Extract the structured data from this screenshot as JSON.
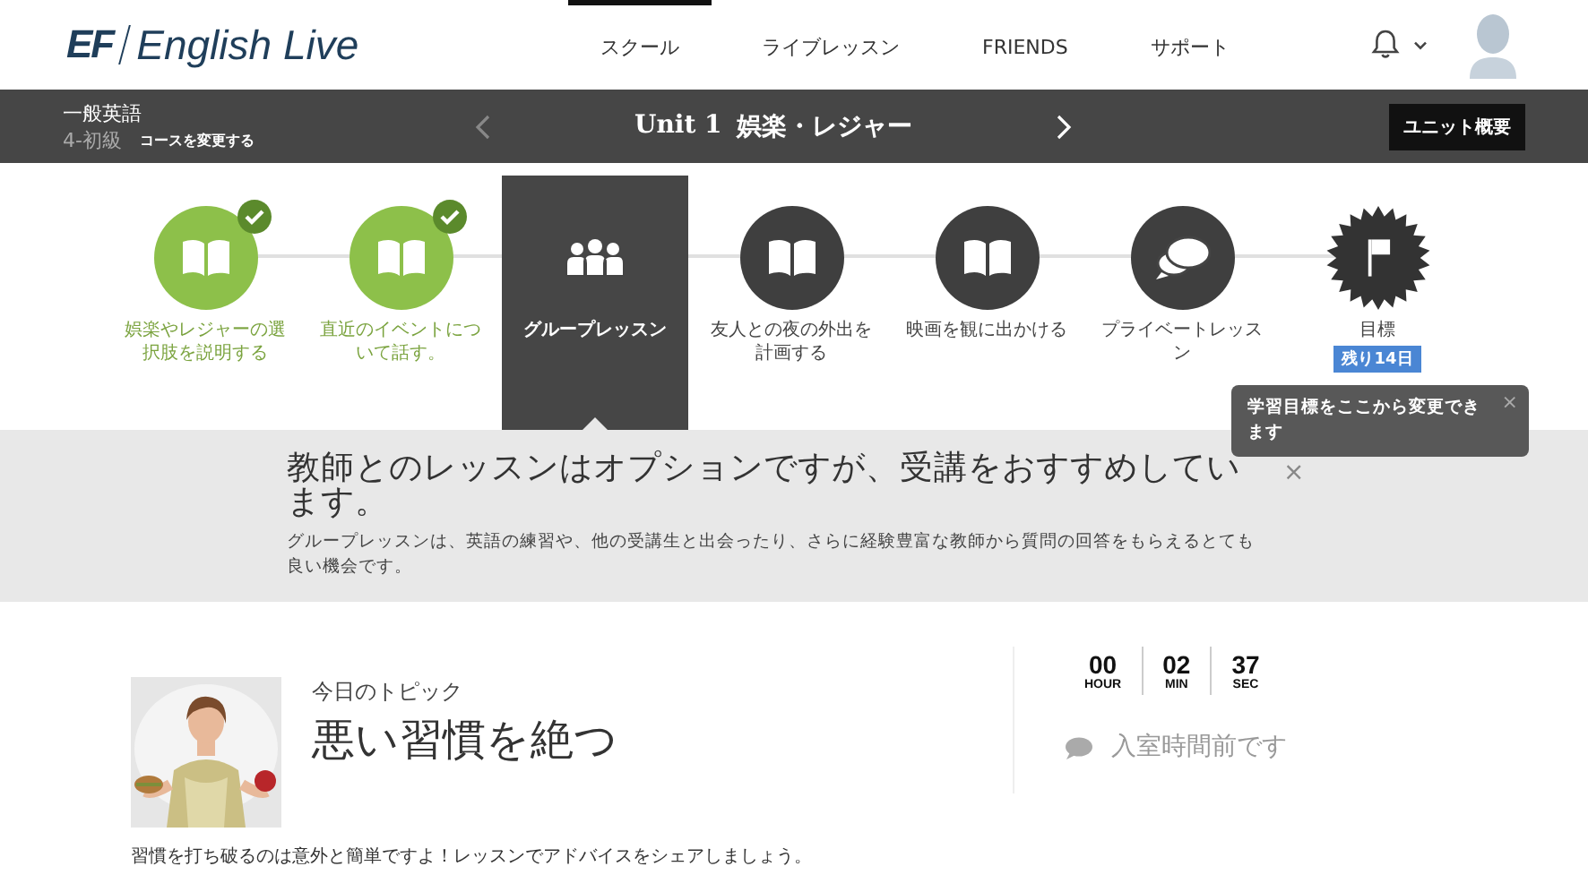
{
  "header": {
    "logo_mark": "EF",
    "logo_text": "English Live",
    "nav": [
      {
        "label": "スクール",
        "selected": true
      },
      {
        "label": "ライブレッスン",
        "selected": false
      },
      {
        "label": "FRIENDS",
        "selected": false
      },
      {
        "label": "サポート",
        "selected": false
      }
    ]
  },
  "course_bar": {
    "course": "一般英語",
    "level": "4-初級",
    "change_link": "コースを変更する",
    "unit_label": "Unit 1",
    "unit_title": "娯楽・レジャー",
    "overview_button": "ユニット概要"
  },
  "steps": [
    {
      "kind": "lesson",
      "label": "娯楽やレジャーの選択肢を説明する",
      "completed": true,
      "selected": false
    },
    {
      "kind": "lesson",
      "label": "直近のイベントについて話す。",
      "completed": true,
      "selected": false
    },
    {
      "kind": "group",
      "label": "グループレッスン",
      "completed": false,
      "selected": true
    },
    {
      "kind": "lesson",
      "label": "友人との夜の外出を計画する",
      "completed": false,
      "selected": false
    },
    {
      "kind": "lesson",
      "label": "映画を観に出かける",
      "completed": false,
      "selected": false
    },
    {
      "kind": "private",
      "label": "プライベートレッスン",
      "completed": false,
      "selected": false
    },
    {
      "kind": "goal",
      "label": "目標",
      "completed": false,
      "selected": false,
      "badge": "残り14日"
    }
  ],
  "tooltip": {
    "text": "学習目標をここから変更できます",
    "close": "×"
  },
  "notice": {
    "title": "教師とのレッスンはオプションですが、受講をおすすめしています。",
    "body": "グループレッスンは、英語の練習や、他の受講生と出会ったり、さらに経験豊富な教師から質問の回答をもらえるとても良い機会です。",
    "close": "×"
  },
  "topic": {
    "kicker": "今日のトピック",
    "title": "悪い習慣を絶つ",
    "description": "習慣を打ち破るのは意外と簡単ですよ！レッスンでアドバイスをシェアしましょう。"
  },
  "timer": [
    {
      "value": "00",
      "unit": "HOUR"
    },
    {
      "value": "02",
      "unit": "MIN"
    },
    {
      "value": "37",
      "unit": "SEC"
    }
  ],
  "room_status": "入室時間前です"
}
